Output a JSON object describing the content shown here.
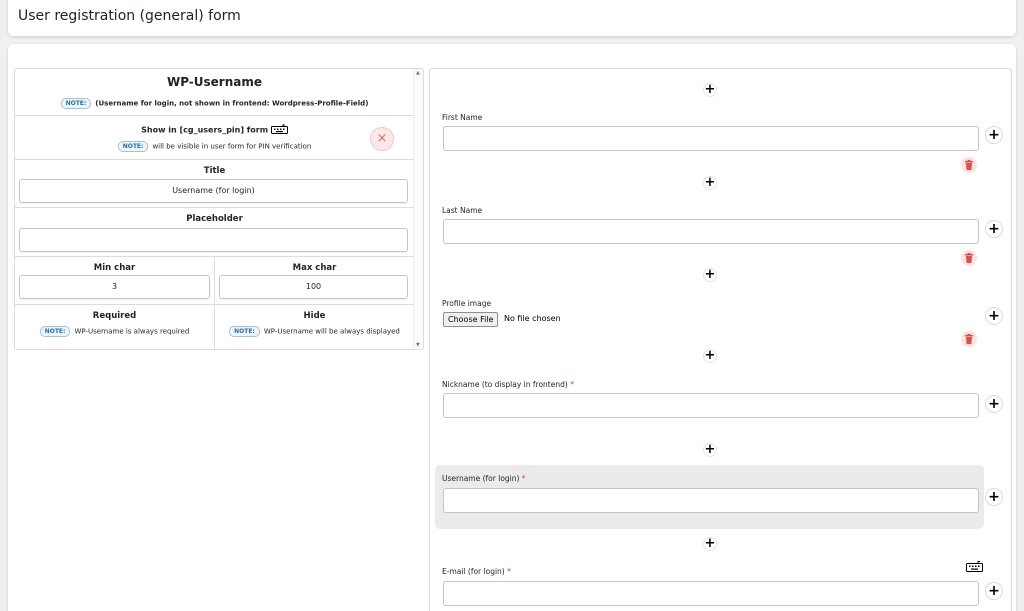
{
  "header": {
    "title": "User registration (general) form"
  },
  "settings": {
    "field_name": "WP-Username",
    "note_badge": "NOTE:",
    "field_note": "(Username for login, not shown in frontend: Wordpress-Profile-Field)",
    "pin_label": "Show in [cg_users_pin] form",
    "pin_note": "will be visible in user form for PIN verification",
    "title_label": "Title",
    "title_value": "Username (for login)",
    "placeholder_label": "Placeholder",
    "placeholder_value": "",
    "min_label": "Min char",
    "min_value": "3",
    "max_label": "Max char",
    "max_value": "100",
    "required_label": "Required",
    "required_note": "WP-Username is always required",
    "hide_label": "Hide",
    "hide_note": "WP-Username will be always displayed",
    "close_glyph": "×"
  },
  "form": {
    "plus_glyph": "+",
    "required_mark": "*",
    "fields": [
      {
        "label": "First Name"
      },
      {
        "label": "Last Name"
      },
      {
        "label": "Profile image",
        "choose_label": "Choose File",
        "no_file": "No file chosen"
      },
      {
        "label": "Nickname (to display in frontend)"
      },
      {
        "label": "Username (for login)"
      },
      {
        "label": "E-mail (for login)"
      }
    ]
  },
  "icons": [
    "plus-icon",
    "trash-icon",
    "close-icon",
    "keyboard-icon",
    "scroll-up-icon",
    "scroll-down-icon"
  ],
  "colors": {
    "note_blue": "#2271b1",
    "danger": "#d63638",
    "trash_bg": "#fde2e2",
    "highlight": "#ebebeb"
  }
}
